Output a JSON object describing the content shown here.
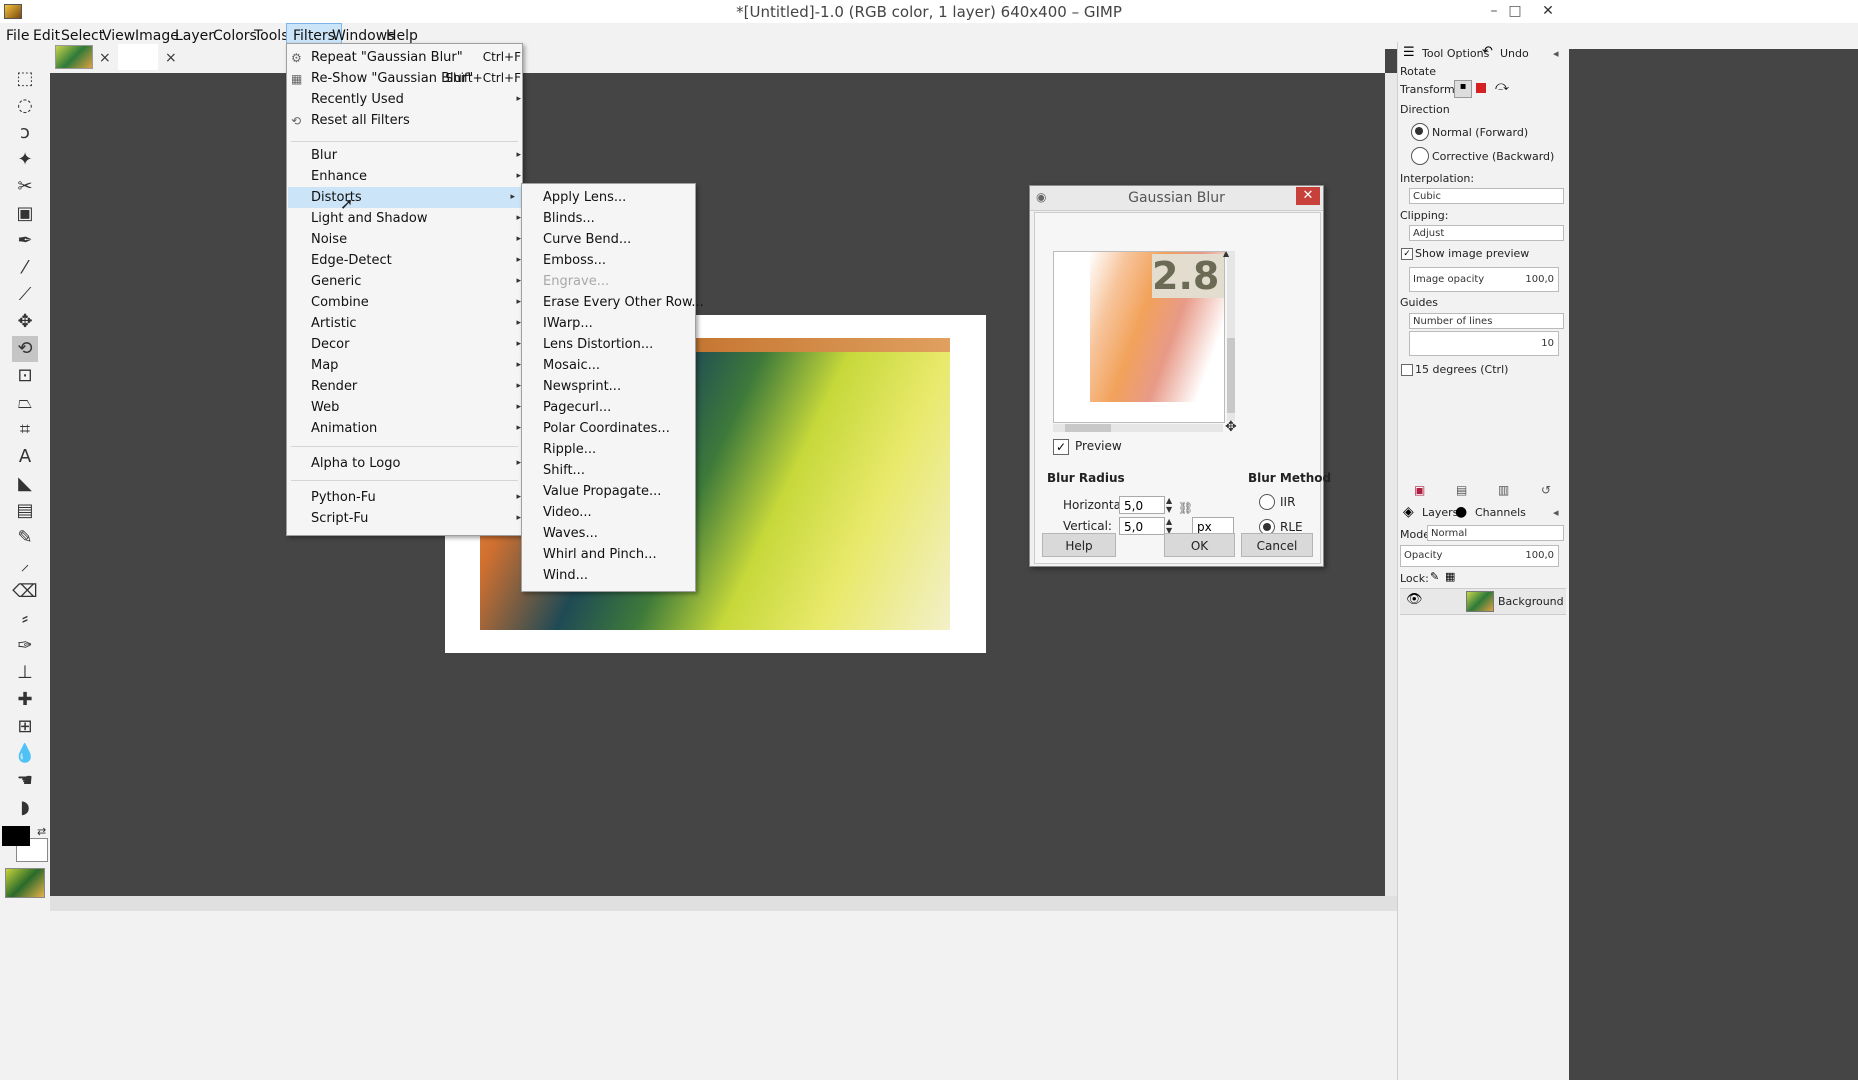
{
  "window": {
    "title": "*[Untitled]-1.0 (RGB color, 1 layer) 640x400 – GIMP",
    "min": "–",
    "max": "□",
    "close": "✕"
  },
  "menubar": [
    "File",
    "Edit",
    "Select",
    "View",
    "Image",
    "Layer",
    "Colors",
    "Tools",
    "Filters",
    "Windows",
    "Help"
  ],
  "tabs": {
    "close": "×"
  },
  "filters_menu": {
    "repeat": {
      "label": "Repeat \"Gaussian Blur\"",
      "accel": "Ctrl+F"
    },
    "reshow": {
      "label": "Re-Show \"Gaussian Blur\"",
      "accel": "Shift+Ctrl+F"
    },
    "recently_used": "Recently Used",
    "reset_all": "Reset all Filters",
    "groups": [
      "Blur",
      "Enhance",
      "Distorts",
      "Light and Shadow",
      "Noise",
      "Edge-Detect",
      "Generic",
      "Combine",
      "Artistic",
      "Decor",
      "Map",
      "Render",
      "Web",
      "Animation"
    ],
    "alpha_to_logo": "Alpha to Logo",
    "python_fu": "Python-Fu",
    "script_fu": "Script-Fu"
  },
  "distorts_menu": [
    "Apply Lens...",
    "Blinds...",
    "Curve Bend...",
    "Emboss...",
    "Engrave...",
    "Erase Every Other Row...",
    "IWarp...",
    "Lens Distortion...",
    "Mosaic...",
    "Newsprint...",
    "Pagecurl...",
    "Polar Coordinates...",
    "Ripple...",
    "Shift...",
    "Value Propagate...",
    "Video...",
    "Waves...",
    "Whirl and Pinch...",
    "Wind..."
  ],
  "gaussian_dialog": {
    "title": "Gaussian Blur",
    "preview_number": "2.8",
    "preview_label": "Preview",
    "blur_radius": "Blur Radius",
    "horizontal_label": "Horizontal:",
    "horizontal_value": "5,0",
    "vertical_label": "Vertical:",
    "vertical_value": "5,0",
    "unit": "px",
    "blur_method": "Blur Method",
    "iir": "IIR",
    "rle": "RLE",
    "help": "Help",
    "ok": "OK",
    "cancel": "Cancel"
  },
  "tool_options": {
    "tab_options": "Tool Options",
    "tab_undo": "Undo",
    "tool_name": "Rotate",
    "transform": "Transform:",
    "direction": "Direction",
    "normal": "Normal (Forward)",
    "corrective": "Corrective (Backward)",
    "interpolation": "Interpolation:",
    "interpolation_value": "Cubic",
    "clipping": "Clipping:",
    "clipping_value": "Adjust",
    "show_preview": "Show image preview",
    "image_opacity": "Image opacity",
    "image_opacity_value": "100,0",
    "guides": "Guides",
    "guides_value": "Number of lines",
    "lines_value": "10",
    "fifteen_deg": "15 degrees  (Ctrl)"
  },
  "layers": {
    "tab_layers": "Layers",
    "tab_channels": "Channels",
    "mode_label": "Mode:",
    "mode_value": "Normal",
    "opacity_label": "Opacity",
    "opacity_value": "100,0",
    "lock_label": "Lock:",
    "layer_name": "Background"
  }
}
